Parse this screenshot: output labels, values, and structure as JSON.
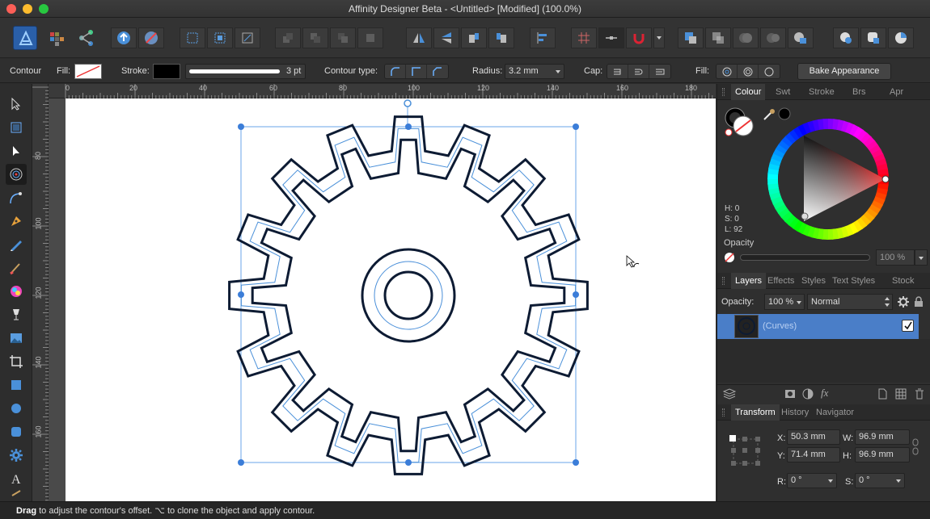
{
  "window": {
    "title": "Affinity Designer Beta - <Untitled> [Modified] (100.0%)",
    "traffic_colors": [
      "#fc5f57",
      "#fdbc2e",
      "#28c840"
    ]
  },
  "context_bar": {
    "tool_name": "Contour",
    "fill_label": "Fill:",
    "stroke_label": "Stroke:",
    "stroke_width": "3 pt",
    "contour_type_label": "Contour type:",
    "radius_label": "Radius:",
    "radius_value": "3.2 mm",
    "cap_label": "Cap:",
    "fill2_label": "Fill:",
    "bake_button": "Bake Appearance"
  },
  "rulers": {
    "unit": "mm",
    "top_ticks": [
      "0",
      "20",
      "40",
      "60",
      "80",
      "100",
      "120",
      "140",
      "160",
      "180"
    ],
    "left_ticks": [
      "80",
      "100",
      "120",
      "140",
      "160"
    ]
  },
  "colour_panel": {
    "tabs": [
      "Colour",
      "Swt",
      "Stroke",
      "Brs",
      "Apr"
    ],
    "h": "H: 0",
    "s": "S: 0",
    "l": "L: 92",
    "opacity_label": "Opacity",
    "opacity_value": "100 %"
  },
  "layers_panel": {
    "tabs": [
      "Layers",
      "Effects",
      "Styles",
      "Text Styles",
      "Stock"
    ],
    "opacity_label": "Opacity:",
    "opacity_value": "100 %",
    "blend_mode": "Normal",
    "layer_name": "(Curves)"
  },
  "transform_panel": {
    "tabs": [
      "Transform",
      "History",
      "Navigator"
    ],
    "x_label": "X:",
    "x_value": "50.3 mm",
    "y_label": "Y:",
    "y_value": "71.4 mm",
    "w_label": "W:",
    "w_value": "96.9 mm",
    "h_label": "H:",
    "h_value": "96.9 mm",
    "r_label": "R:",
    "r_value": "0 °",
    "s_label": "S:",
    "s_value": "0 °"
  },
  "status": {
    "bold": "Drag",
    "text": " to adjust the contour's offset. ⌥ to clone the object and apply contour."
  },
  "colors": {
    "accent": "#4a90d9",
    "selection": "#3b7dd8",
    "gear_stroke": "#0d1b33",
    "panel_bg": "#2f2f2f"
  }
}
